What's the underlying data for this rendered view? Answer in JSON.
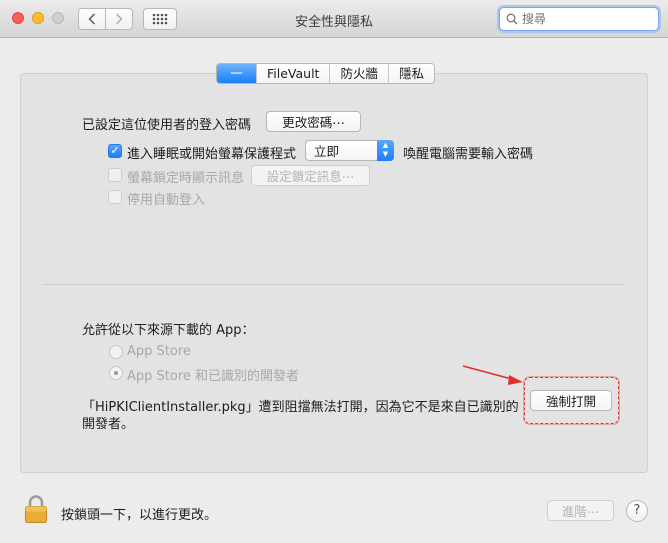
{
  "window": {
    "title": "安全性與隱私"
  },
  "search": {
    "placeholder": "搜尋"
  },
  "tabs": [
    {
      "label": "一般",
      "active": true
    },
    {
      "label": "FileVault",
      "active": false
    },
    {
      "label": "防火牆",
      "active": false
    },
    {
      "label": "隱私",
      "active": false
    }
  ],
  "general": {
    "password_label": "已設定這位使用者的登入密碼",
    "change_password_button": "更改密碼⋯",
    "require_password": {
      "label": "進入睡眠或開始螢幕保護程式",
      "checked": true,
      "delay_value": "立即",
      "suffix": "喚醒電腦需要輸入密碼"
    },
    "show_message": {
      "label": "螢幕鎖定時顯示訊息",
      "checked": false,
      "disabled": true
    },
    "set_lock_message_button": "設定鎖定訊息⋯",
    "disable_autologin": {
      "label": "停用自動登入",
      "checked": false,
      "disabled": true
    }
  },
  "downloads": {
    "heading": "允許從以下來源下載的 App：",
    "options": [
      {
        "label": "App Store",
        "selected": false
      },
      {
        "label": "App Store 和已識別的開發者",
        "selected": true
      }
    ],
    "blocked_message_line1": "「HiPKIClientInstaller.pkg」遭到阻擋無法打開，因為它不是來自已識別的",
    "blocked_message_line2": "開發者。",
    "open_anyway_button": "強制打開"
  },
  "footer": {
    "lock_text": "按鎖頭一下，以進行更改。",
    "advanced_button": "進階⋯",
    "help_label": "?"
  },
  "colors": {
    "accent": "#1a7ff6",
    "annotation_red": "#e0302b"
  }
}
